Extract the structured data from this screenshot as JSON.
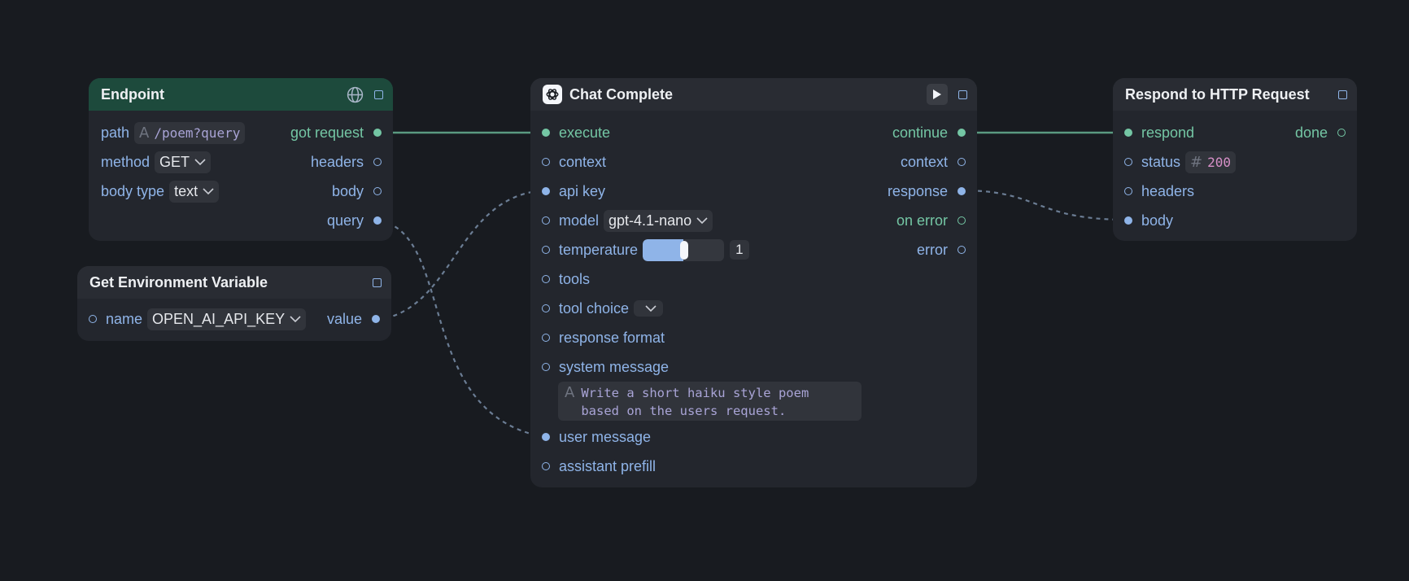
{
  "colors": {
    "background": "#181b20",
    "node": "#23262d",
    "header": "#292c33",
    "endpoint_header": "#1d4a3c",
    "port_blue": "#8fb4e8",
    "port_green": "#74c6a4",
    "wire_exec": "#5a9a80",
    "wire_data": "#6b7d94"
  },
  "endpoint": {
    "title": "Endpoint",
    "icon": "globe-icon",
    "path_label": "path",
    "path_value": "/poem?query",
    "method_label": "method",
    "method_value": "GET",
    "body_type_label": "body type",
    "body_type_value": "text",
    "outputs": [
      "got request",
      "headers",
      "body",
      "query"
    ]
  },
  "env_var": {
    "title": "Get Environment Variable",
    "name_label": "name",
    "name_value": "OPEN_AI_API_KEY",
    "value_label": "value"
  },
  "chat": {
    "title": "Chat Complete",
    "logo": "openai-logo-icon",
    "run_icon": "play-icon",
    "inputs": {
      "execute": "execute",
      "context": "context",
      "api_key": "api key",
      "model": "model",
      "model_value": "gpt-4.1-nano",
      "temperature": "temperature",
      "temperature_value": "1",
      "temperature_fill": 0.5,
      "tools": "tools",
      "tool_choice": "tool choice",
      "tool_choice_value": "",
      "response_format": "response format",
      "system_message": "system message",
      "system_message_line1": "Write a short haiku style poem",
      "system_message_line2": "based on the users request.",
      "user_message": "user message",
      "assistant_prefill": "assistant prefill"
    },
    "outputs": {
      "continue": "continue",
      "context": "context",
      "response": "response",
      "on_error": "on error",
      "error": "error"
    }
  },
  "respond": {
    "title": "Respond to HTTP Request",
    "inputs": {
      "respond": "respond",
      "status": "status",
      "status_value": "200",
      "headers": "headers",
      "body": "body"
    },
    "outputs": {
      "done": "done"
    }
  }
}
